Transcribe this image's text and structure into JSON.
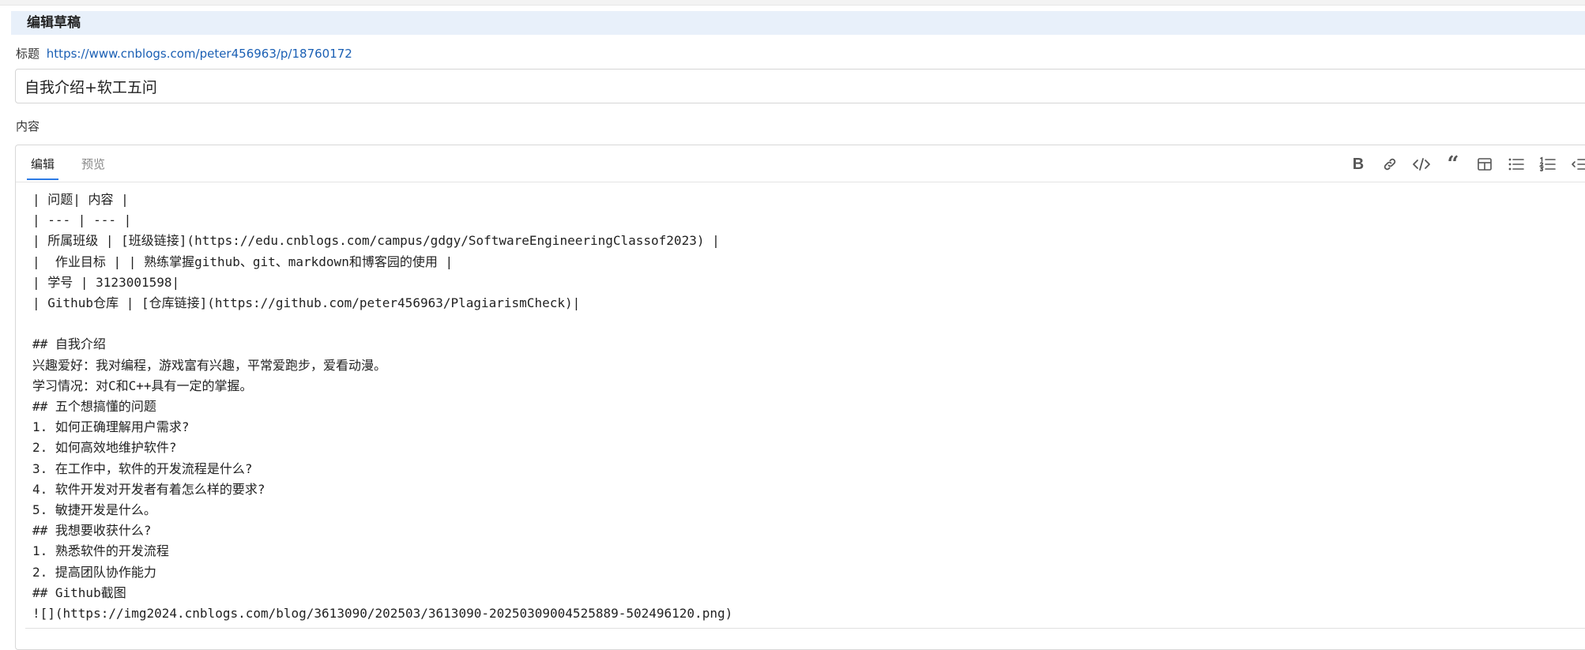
{
  "section": {
    "title": "编辑草稿"
  },
  "title_field": {
    "label": "标题",
    "url": "https://www.cnblogs.com/peter456963/p/18760172",
    "value": "自我介绍+软工五问"
  },
  "content_field": {
    "label": "内容"
  },
  "editor": {
    "tabs": [
      {
        "label": "编辑",
        "active": true
      },
      {
        "label": "预览",
        "active": false
      }
    ],
    "toolbar": [
      {
        "name": "bold-icon",
        "glyph": "B"
      },
      {
        "name": "link-icon"
      },
      {
        "name": "code-icon"
      },
      {
        "name": "quote-icon",
        "glyph": "“"
      },
      {
        "name": "table-icon"
      },
      {
        "name": "unordered-list-icon"
      },
      {
        "name": "ordered-list-icon"
      },
      {
        "name": "indent-icon"
      }
    ],
    "lines": [
      "| 问题| 内容 |",
      "| --- | --- |",
      "| 所属班级 | [班级链接](https://edu.cnblogs.com/campus/gdgy/SoftwareEngineeringClassof2023) |",
      "|  作业目标 | | 熟练掌握github、git、markdown和博客园的使用 |",
      "| 学号 | 3123001598|",
      "| Github仓库 | [仓库链接](https://github.com/peter456963/PlagiarismCheck)|",
      "",
      "## 自我介绍",
      "兴趣爱好：我对编程，游戏富有兴趣，平常爱跑步，爱看动漫。",
      "学习情况：对C和C++具有一定的掌握。",
      "## 五个想搞懂的问题",
      "1. 如何正确理解用户需求?",
      "2. 如何高效地维护软件?",
      "3. 在工作中，软件的开发流程是什么?",
      "4. 软件开发对开发者有着怎么样的要求?",
      "5. 敏捷开发是什么。",
      "## 我想要收获什么?",
      "1. 熟悉软件的开发流程",
      "2. 提高团队协作能力",
      "## Github截图",
      "![](https://img2024.cnblogs.com/blog/3613090/202503/3613090-20250309004525889-502496120.png)"
    ]
  },
  "colors": {
    "header_bg": "#e8f0fa",
    "link": "#1a5fb4",
    "tab_active_underline": "#2d7be5",
    "tab_inactive": "#888888",
    "icon": "#555555"
  }
}
